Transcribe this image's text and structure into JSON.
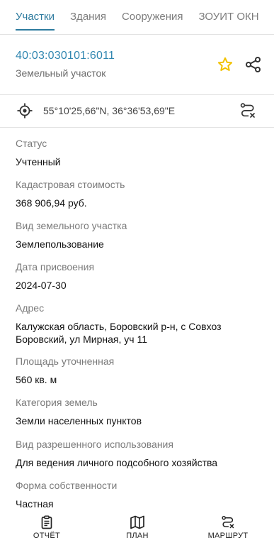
{
  "tabs": [
    "Участки",
    "Здания",
    "Сооружения",
    "ЗОУИТ ОКН"
  ],
  "parcel": {
    "cadastral_number": "40:03:030101:6011",
    "type": "Земельный участок"
  },
  "coordinates": "55°10'25,66\"N, 36°36'53,69\"E",
  "fields": [
    {
      "label": "Статус",
      "value": "Учтенный"
    },
    {
      "label": "Кадастровая стоимость",
      "value": "368 906,94 руб."
    },
    {
      "label": "Вид земельного участка",
      "value": "Землепользование"
    },
    {
      "label": "Дата присвоения",
      "value": "2024-07-30"
    },
    {
      "label": "Адрес",
      "value": "Калужская область, Боровский р-н, с Совхоз Боровский, ул Мирная, уч 11"
    },
    {
      "label": "Площадь уточненная",
      "value": "560 кв. м"
    },
    {
      "label": "Категория земель",
      "value": "Земли населенных пунктов"
    },
    {
      "label": "Вид разрешенного использования",
      "value": "Для ведения личного подсобного хозяйства"
    },
    {
      "label": "Форма собственности",
      "value": "Частная"
    }
  ],
  "bottom_nav": {
    "report": "ОТЧЁТ",
    "plan": "ПЛАН",
    "route": "МАРШРУТ"
  },
  "colors": {
    "accent": "#2c7a9e",
    "link": "#2f86b0",
    "star": "#f2c200"
  },
  "icons": [
    "star-icon",
    "share-icon",
    "target-icon",
    "route-clear-icon",
    "report-icon",
    "map-icon",
    "route-icon"
  ]
}
